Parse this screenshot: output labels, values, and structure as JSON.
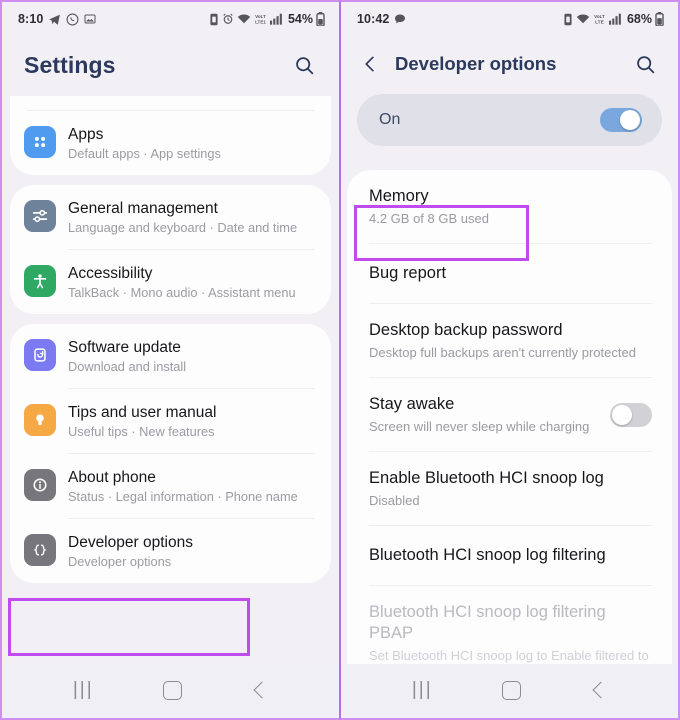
{
  "left_phone": {
    "status_bar": {
      "time": "8:10",
      "left_icons": [
        "telegram-icon",
        "whatsapp-icon",
        "gallery-icon"
      ],
      "right_icons": [
        "nfc-icon",
        "alarm-icon",
        "wifi-icon",
        "volte-icon",
        "signal-icon"
      ],
      "battery_percent": "54%"
    },
    "header": {
      "title": "Settings",
      "search_icon": "search-icon"
    },
    "groups": [
      {
        "items": [
          {
            "title": "Apps",
            "subtitle": "Default apps  ·  App settings",
            "icon": "apps-grid-icon",
            "icon_color": "#4e9bf0"
          },
          {
            "title": "General management",
            "subtitle": "Language and keyboard  ·  Date and time",
            "icon": "sliders-icon",
            "icon_color": "#6e8399"
          },
          {
            "title": "Accessibility",
            "subtitle": "TalkBack  ·  Mono audio  ·  Assistant menu",
            "icon": "accessibility-person-icon",
            "icon_color": "#2fa864"
          }
        ]
      },
      {
        "items": [
          {
            "title": "Software update",
            "subtitle": "Download and install",
            "icon": "software-update-icon",
            "icon_color": "#7b7af0"
          },
          {
            "title": "Tips and user manual",
            "subtitle": "Useful tips  ·  New features",
            "icon": "lightbulb-icon",
            "icon_color": "#f5a843"
          },
          {
            "title": "About phone",
            "subtitle": "Status  ·  Legal information  ·  Phone name",
            "icon": "info-circle-icon",
            "icon_color": "#76767c"
          },
          {
            "title": "Developer options",
            "subtitle": "Developer options",
            "icon": "developer-braces-icon",
            "icon_color": "#76767c",
            "highlighted": true
          }
        ]
      }
    ],
    "nav_bar": {
      "recents": "recents-icon",
      "home": "home-icon",
      "back": "back-icon"
    }
  },
  "right_phone": {
    "status_bar": {
      "time": "10:42",
      "left_icons": [
        "messaging-icon"
      ],
      "right_icons": [
        "nfc-icon",
        "wifi-icon",
        "volte-icon",
        "signal-icon"
      ],
      "battery_percent": "68%"
    },
    "header": {
      "back_icon": "back-chevron-icon",
      "title": "Developer options",
      "search_icon": "search-icon"
    },
    "master_switch": {
      "label": "On",
      "state": "on"
    },
    "items": [
      {
        "title": "Memory",
        "subtitle": "4.2 GB of 8 GB used",
        "highlighted": true
      },
      {
        "title": "Bug report",
        "subtitle": ""
      },
      {
        "title": "Desktop backup password",
        "subtitle": "Desktop full backups aren't currently protected"
      },
      {
        "title": "Stay awake",
        "subtitle": "Screen will never sleep while charging",
        "toggle": "off"
      },
      {
        "title": "Enable Bluetooth HCI snoop log",
        "subtitle": "Disabled"
      },
      {
        "title": "Bluetooth HCI snoop log filtering",
        "subtitle": ""
      },
      {
        "title": "Bluetooth HCI snoop log filtering PBAP",
        "subtitle": "Set Bluetooth HCI snoop log to Enable filtered to change this option",
        "disabled": true
      }
    ],
    "nav_bar": {
      "recents": "recents-icon",
      "home": "home-icon",
      "back": "back-icon"
    }
  },
  "annotation": {
    "highlight_color": "#c04cf0"
  }
}
